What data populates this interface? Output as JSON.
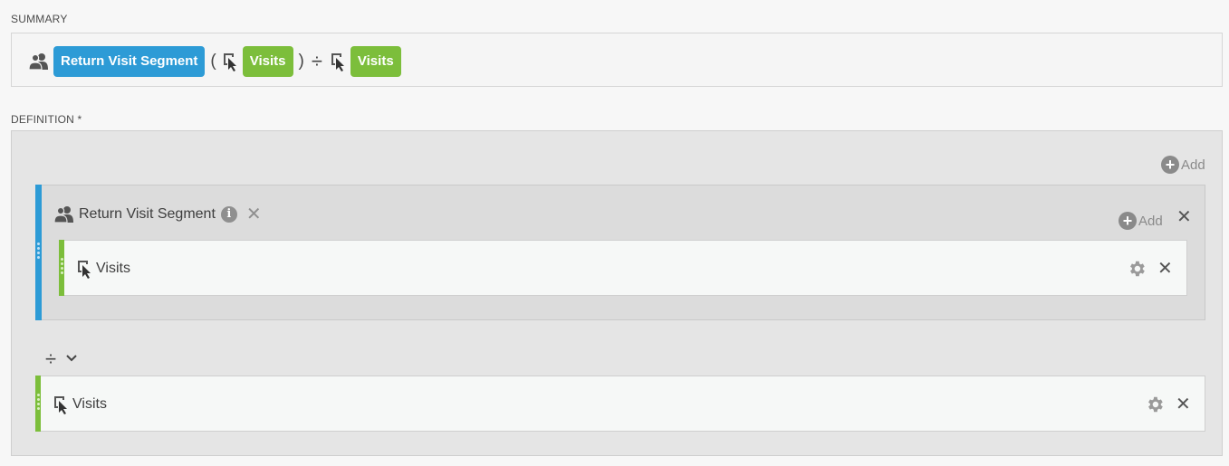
{
  "summary": {
    "label": "SUMMARY",
    "segment_pill": "Return Visit Segment",
    "open_paren": "(",
    "metric1_pill": "Visits",
    "close_paren": ")",
    "operator": "÷",
    "metric2_pill": "Visits"
  },
  "definition": {
    "label": "DEFINITION *",
    "add_label": "Add",
    "segment": {
      "title": "Return Visit Segment",
      "info_glyph": "i",
      "add_label": "Add",
      "metric": "Visits"
    },
    "operator_symbol": "÷",
    "metric": "Visits"
  },
  "colors": {
    "segment_blue": "#2d9bd6",
    "metric_green": "#7cbe3b"
  },
  "icons": {
    "segment": "segment-people-icon",
    "metric": "metric-cursor-icon",
    "add": "plus-circle-icon",
    "close": "close-icon",
    "settings": "gear-icon",
    "info": "info-icon",
    "dropdown": "chevron-down-icon"
  }
}
